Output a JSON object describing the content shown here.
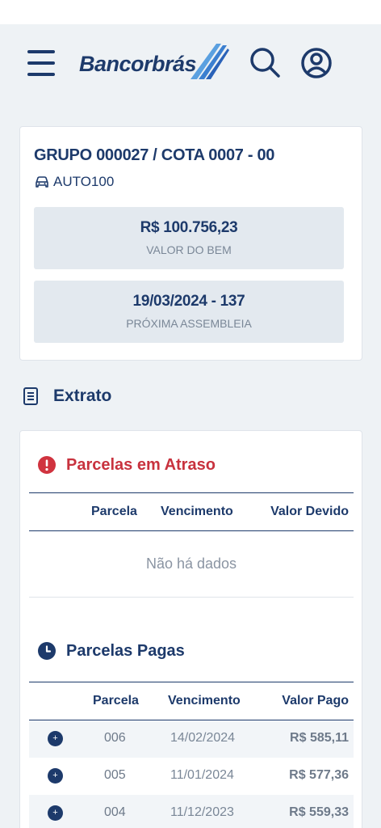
{
  "header": {
    "logo_text": "Bancorbrás",
    "menu_icon": "hamburger-menu-icon",
    "search_icon": "search-icon",
    "profile_icon": "user-profile-icon"
  },
  "group_card": {
    "title": "GRUPO 000027 / COTA 0007 - 00",
    "plan_icon": "car-icon",
    "plan_name": "AUTO100",
    "asset_value": "R$ 100.756,23",
    "asset_value_label": "VALOR DO BEM",
    "next_assembly": "19/03/2024 - 137",
    "next_assembly_label": "PRÓXIMA ASSEMBLEIA"
  },
  "statement": {
    "heading": "Extrato",
    "heading_icon": "document-list-icon"
  },
  "overdue": {
    "heading": "Parcelas em Atraso",
    "icon": "exclamation-circle-icon",
    "columns": [
      "Parcela",
      "Vencimento",
      "Valor Devido"
    ],
    "empty_text": "Não há dados"
  },
  "paid": {
    "heading": "Parcelas Pagas",
    "icon": "clock-icon",
    "columns": [
      "Parcela",
      "Vencimento",
      "Valor Pago"
    ],
    "rows": [
      {
        "parcela": "006",
        "vencimento": "14/02/2024",
        "valor": "R$ 585,11"
      },
      {
        "parcela": "005",
        "vencimento": "11/01/2024",
        "valor": "R$ 577,36"
      },
      {
        "parcela": "004",
        "vencimento": "11/12/2023",
        "valor": "R$ 559,33"
      }
    ],
    "expand_symbol": "+"
  },
  "colors": {
    "primary": "#1d3a6b",
    "danger": "#d0333f",
    "background": "#eef2f5",
    "muted_text": "#7a8797"
  }
}
